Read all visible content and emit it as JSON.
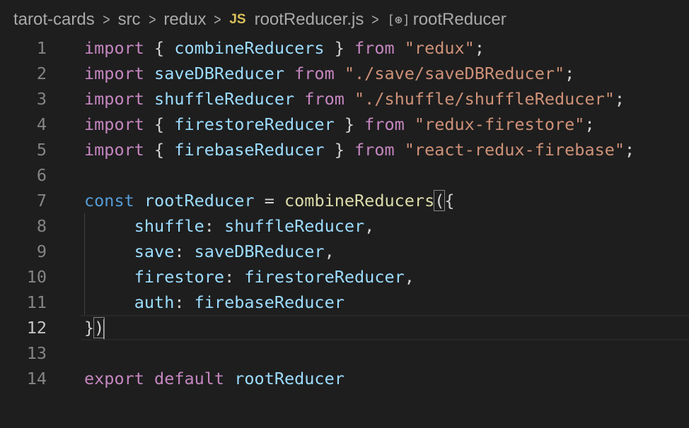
{
  "breadcrumb": {
    "project": "tarot-cards",
    "folder1": "src",
    "folder2": "redux",
    "file_icon": "JS",
    "file": "rootReducer.js",
    "symbol_icon": "[⊛]",
    "symbol": "rootReducer",
    "separator": ">"
  },
  "editor": {
    "current_line": 12,
    "colors": {
      "background": "#1e1e1e",
      "keyword": "#c586c0",
      "function": "#dcdcaa",
      "variable": "#9cdcfe",
      "string": "#ce9178",
      "line_number": "#858585"
    },
    "lines": [
      {
        "n": "1",
        "tokens": [
          [
            "kw",
            "import"
          ],
          [
            "plain",
            " { "
          ],
          [
            "var",
            "combineReducers"
          ],
          [
            "plain",
            " } "
          ],
          [
            "kw",
            "from"
          ],
          [
            "plain",
            " "
          ],
          [
            "str",
            "\"redux\""
          ],
          [
            "plain",
            ";"
          ]
        ]
      },
      {
        "n": "2",
        "tokens": [
          [
            "kw",
            "import"
          ],
          [
            "plain",
            " "
          ],
          [
            "var",
            "saveDBReducer"
          ],
          [
            "plain",
            " "
          ],
          [
            "kw",
            "from"
          ],
          [
            "plain",
            " "
          ],
          [
            "str",
            "\"./save/saveDBReducer\""
          ],
          [
            "plain",
            ";"
          ]
        ]
      },
      {
        "n": "3",
        "tokens": [
          [
            "kw",
            "import"
          ],
          [
            "plain",
            " "
          ],
          [
            "var",
            "shuffleReducer"
          ],
          [
            "plain",
            " "
          ],
          [
            "kw",
            "from"
          ],
          [
            "plain",
            " "
          ],
          [
            "str",
            "\"./shuffle/shuffleReducer\""
          ],
          [
            "plain",
            ";"
          ]
        ]
      },
      {
        "n": "4",
        "tokens": [
          [
            "kw",
            "import"
          ],
          [
            "plain",
            " { "
          ],
          [
            "var",
            "firestoreReducer"
          ],
          [
            "plain",
            " } "
          ],
          [
            "kw",
            "from"
          ],
          [
            "plain",
            " "
          ],
          [
            "str",
            "\"redux-firestore\""
          ],
          [
            "plain",
            ";"
          ]
        ]
      },
      {
        "n": "5",
        "tokens": [
          [
            "kw",
            "import"
          ],
          [
            "plain",
            " { "
          ],
          [
            "var",
            "firebaseReducer"
          ],
          [
            "plain",
            " } "
          ],
          [
            "kw",
            "from"
          ],
          [
            "plain",
            " "
          ],
          [
            "str",
            "\"react-redux-firebase\""
          ],
          [
            "plain",
            ";"
          ]
        ]
      },
      {
        "n": "6",
        "tokens": []
      },
      {
        "n": "7",
        "tokens": [
          [
            "kw2",
            "const"
          ],
          [
            "plain",
            " "
          ],
          [
            "var",
            "rootReducer"
          ],
          [
            "plain",
            " = "
          ],
          [
            "fn",
            "combineReducers"
          ],
          [
            "plain",
            "("
          ],
          [
            "plain",
            "{"
          ]
        ]
      },
      {
        "n": "8",
        "tokens": [
          [
            "plain",
            "     "
          ],
          [
            "var",
            "shuffle"
          ],
          [
            "plain",
            ": "
          ],
          [
            "var",
            "shuffleReducer"
          ],
          [
            "plain",
            ","
          ]
        ]
      },
      {
        "n": "9",
        "tokens": [
          [
            "plain",
            "     "
          ],
          [
            "var",
            "save"
          ],
          [
            "plain",
            ": "
          ],
          [
            "var",
            "saveDBReducer"
          ],
          [
            "plain",
            ","
          ]
        ]
      },
      {
        "n": "10",
        "tokens": [
          [
            "plain",
            "     "
          ],
          [
            "var",
            "firestore"
          ],
          [
            "plain",
            ": "
          ],
          [
            "var",
            "firestoreReducer"
          ],
          [
            "plain",
            ","
          ]
        ]
      },
      {
        "n": "11",
        "tokens": [
          [
            "plain",
            "     "
          ],
          [
            "var",
            "auth"
          ],
          [
            "plain",
            ": "
          ],
          [
            "var",
            "firebaseReducer"
          ]
        ]
      },
      {
        "n": "12",
        "tokens": [
          [
            "plain",
            "}"
          ],
          [
            "plain",
            ")"
          ]
        ]
      },
      {
        "n": "13",
        "tokens": []
      },
      {
        "n": "14",
        "tokens": [
          [
            "kw",
            "export"
          ],
          [
            "plain",
            " "
          ],
          [
            "kw",
            "default"
          ],
          [
            "plain",
            " "
          ],
          [
            "var",
            "rootReducer"
          ]
        ]
      }
    ]
  }
}
